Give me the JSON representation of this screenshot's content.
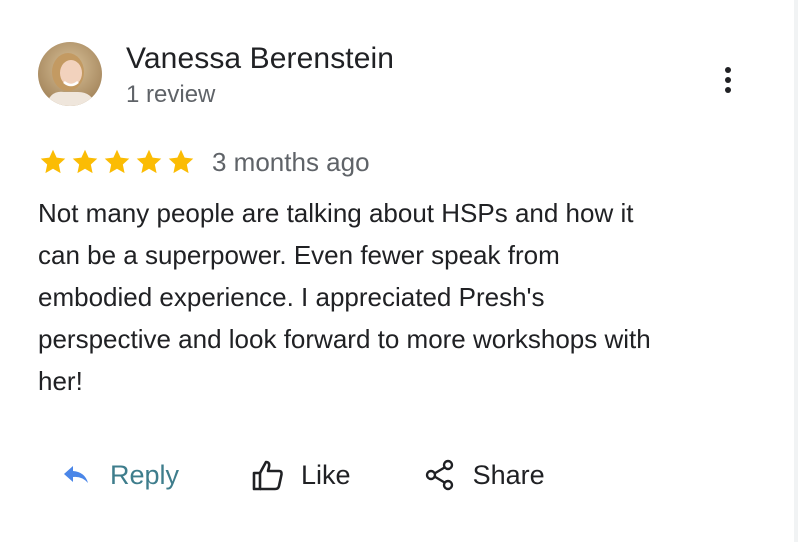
{
  "review": {
    "author": {
      "name": "Vanessa Berenstein",
      "meta": "1 review"
    },
    "rating": 5,
    "max_rating": 5,
    "date": "3 months ago",
    "text": "Not many people are talking about HSPs and how it\ncan be a superpower. Even fewer speak from\nembodied experience. I appreciated Presh's\nperspective and look forward to more workshops with\nher!"
  },
  "actions": {
    "reply_label": "Reply",
    "like_label": "Like",
    "share_label": "Share"
  },
  "icons": {
    "more": "more-vert-icon",
    "star": "star-icon",
    "reply": "reply-arrow-icon",
    "like": "thumbs-up-icon",
    "share": "share-icon"
  },
  "colors": {
    "star": "#fbbc04",
    "reply_accent": "#3e7d8c",
    "reply_icon": "#4a86e8",
    "text_primary": "#202124",
    "text_secondary": "#5f6368"
  }
}
